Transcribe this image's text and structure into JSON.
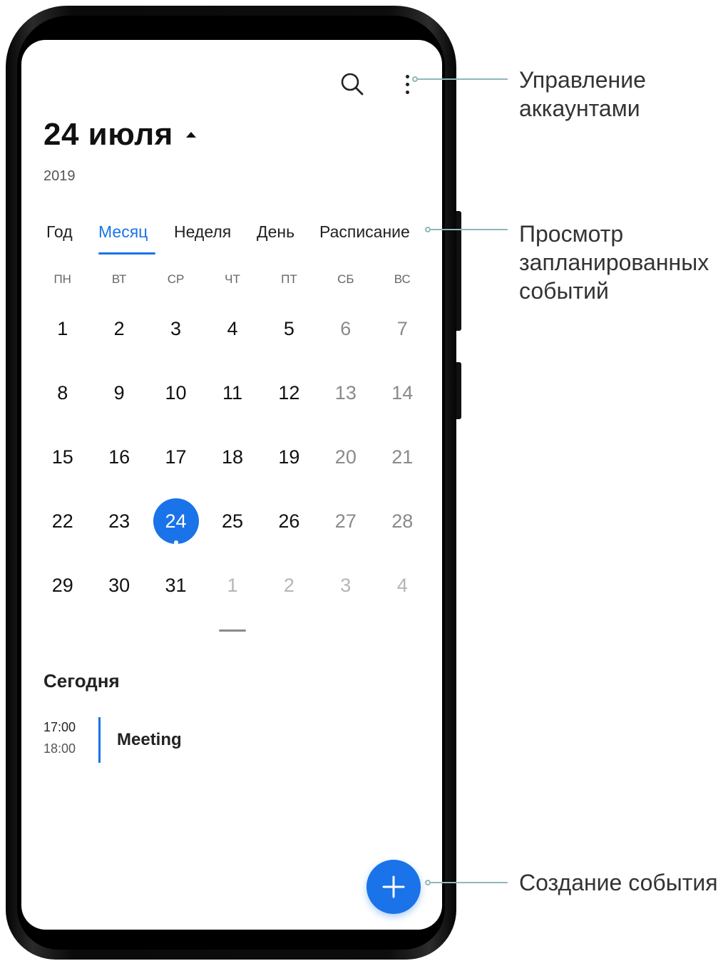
{
  "header": {
    "date_title": "24 июля",
    "year": "2019",
    "icons": {
      "search": "search-icon",
      "more": "more-vert-icon",
      "caret": "caret-up-icon"
    }
  },
  "tabs": [
    {
      "label": "Год",
      "active": false
    },
    {
      "label": "Месяц",
      "active": true
    },
    {
      "label": "Неделя",
      "active": false
    },
    {
      "label": "День",
      "active": false
    },
    {
      "label": "Расписание",
      "active": false
    }
  ],
  "weekdays": [
    "ПН",
    "ВТ",
    "СР",
    "ЧТ",
    "ПТ",
    "СБ",
    "ВС"
  ],
  "calendar": {
    "weeks": [
      [
        {
          "d": "1"
        },
        {
          "d": "2"
        },
        {
          "d": "3"
        },
        {
          "d": "4"
        },
        {
          "d": "5"
        },
        {
          "d": "6",
          "w": true
        },
        {
          "d": "7",
          "w": true
        }
      ],
      [
        {
          "d": "8"
        },
        {
          "d": "9"
        },
        {
          "d": "10"
        },
        {
          "d": "11"
        },
        {
          "d": "12"
        },
        {
          "d": "13",
          "w": true
        },
        {
          "d": "14",
          "w": true
        }
      ],
      [
        {
          "d": "15"
        },
        {
          "d": "16"
        },
        {
          "d": "17"
        },
        {
          "d": "18"
        },
        {
          "d": "19"
        },
        {
          "d": "20",
          "w": true
        },
        {
          "d": "21",
          "w": true
        }
      ],
      [
        {
          "d": "22"
        },
        {
          "d": "23"
        },
        {
          "d": "24",
          "today": true,
          "event": true
        },
        {
          "d": "25"
        },
        {
          "d": "26"
        },
        {
          "d": "27",
          "w": true
        },
        {
          "d": "28",
          "w": true
        }
      ],
      [
        {
          "d": "29"
        },
        {
          "d": "30"
        },
        {
          "d": "31"
        },
        {
          "d": "1",
          "o": true
        },
        {
          "d": "2",
          "o": true
        },
        {
          "d": "3",
          "o": true
        },
        {
          "d": "4",
          "o": true
        }
      ]
    ]
  },
  "agenda": {
    "title": "Сегодня",
    "events": [
      {
        "start": "17:00",
        "end": "18:00",
        "title": "Meeting"
      }
    ]
  },
  "fab": {
    "icon": "plus-icon"
  },
  "callouts": {
    "accounts": [
      "Управление",
      "аккаунтами"
    ],
    "schedule": [
      "Просмотр",
      "запланированных",
      "событий"
    ],
    "create": [
      "Создание события"
    ]
  },
  "colors": {
    "accent": "#1a73e8",
    "callout_line": "#8fb7bd"
  }
}
